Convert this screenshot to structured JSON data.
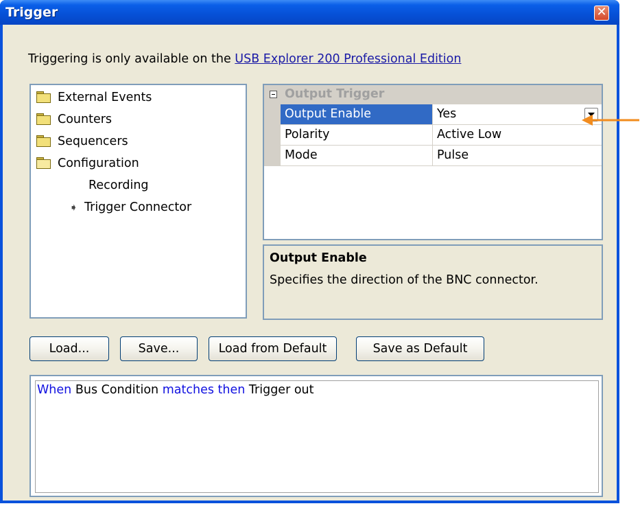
{
  "window": {
    "title": "Trigger"
  },
  "info": {
    "text": "Triggering is only available on the ",
    "link": "USB Explorer 200 Professional Edition"
  },
  "tree": {
    "items": [
      {
        "label": "External Events",
        "icon": "folder-icon"
      },
      {
        "label": "Counters",
        "icon": "folder-icon"
      },
      {
        "label": "Sequencers",
        "icon": "folder-icon"
      },
      {
        "label": "Configuration",
        "icon": "folder-open-icon"
      },
      {
        "label": "Recording"
      },
      {
        "label": "Trigger Connector",
        "icon": "arrow-right-icon"
      }
    ]
  },
  "properties": {
    "category": "Output Trigger",
    "rows": [
      {
        "name": "Output Enable",
        "value": "Yes",
        "selected": true
      },
      {
        "name": "Polarity",
        "value": "Active Low"
      },
      {
        "name": "Mode",
        "value": "Pulse"
      }
    ]
  },
  "description": {
    "title": "Output Enable",
    "text": "Specifies the direction of the BNC connector."
  },
  "buttons": {
    "load": "Load...",
    "save": "Save...",
    "load_default": "Load from Default",
    "save_default": "Save as Default"
  },
  "editor": {
    "w1": "When",
    "w2": "Bus Condition",
    "w3": "matches then",
    "w4": "Trigger out"
  },
  "colors": {
    "titlebar": "#0650D6",
    "selection": "#316AC5",
    "keyword": "#1010E0",
    "pointer": "#F28C1E"
  }
}
